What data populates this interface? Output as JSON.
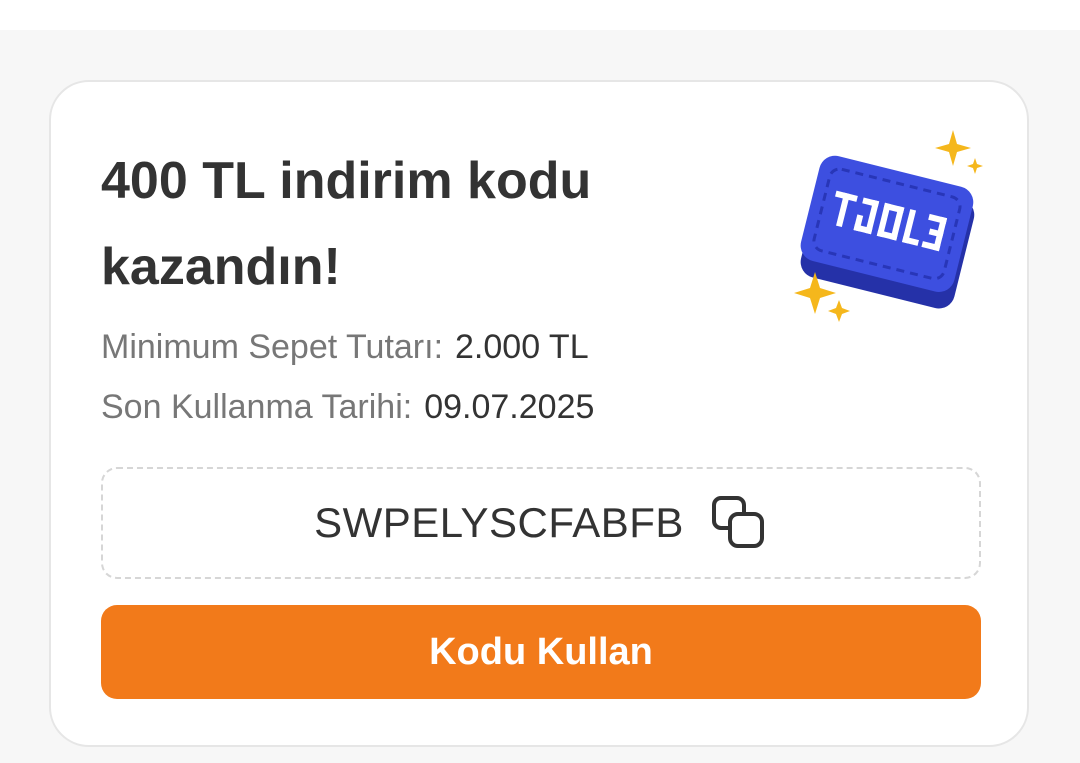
{
  "coupon": {
    "title": "400 TL indirim kodu kazandın!",
    "min_label": "Minimum Sepet Tutarı:",
    "min_value": "2.000 TL",
    "expiry_label": "Son Kullanma Tarihi:",
    "expiry_value": "09.07.2025",
    "code": "SWPELYSCFABFB",
    "use_button_label": "Kodu Kullan",
    "copy_icon": "copy-icon",
    "illustration_icon": "coupon-ticket-icon"
  },
  "colors": {
    "accent": "#f27a1a",
    "coupon_blue": "#3d4fe0",
    "sparkle": "#f5b71c",
    "text_dark": "#333333",
    "text_muted": "#777777"
  }
}
